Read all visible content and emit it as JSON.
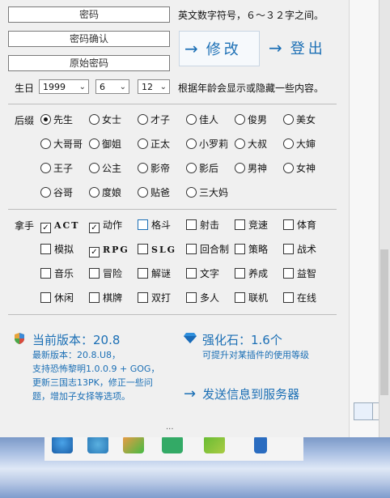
{
  "fields": {
    "password": "密码",
    "confirm": "密码确认",
    "original": "原始密码"
  },
  "password_hint": "英文数字符号，６～３２字之间。",
  "buttons": {
    "modify": "修改",
    "login": "登出"
  },
  "birthday": {
    "label": "生日",
    "year": "1999",
    "month": "6",
    "day": "12",
    "hint": "根据年龄会显示或隐藏一些内容。"
  },
  "suffix": {
    "label": "后缀",
    "options": [
      "先生",
      "女士",
      "才子",
      "佳人",
      "俊男",
      "美女",
      "大哥哥",
      "御姐",
      "正太",
      "小罗莉",
      "大叔",
      "大婶",
      "王子",
      "公主",
      "影帝",
      "影后",
      "男神",
      "女神",
      "谷哥",
      "度娘",
      "贴爸",
      "三大妈"
    ],
    "selected": "先生"
  },
  "skills": {
    "label": "拿手",
    "options": [
      "ACT",
      "动作",
      "格斗",
      "射击",
      "竞速",
      "体育",
      "模拟",
      "RPG",
      "SLG",
      "回合制",
      "策略",
      "战术",
      "音乐",
      "冒险",
      "解谜",
      "文字",
      "养成",
      "益智",
      "休闲",
      "棋牌",
      "双打",
      "多人",
      "联机",
      "在线"
    ],
    "checked": [
      "ACT",
      "动作",
      "RPG"
    ]
  },
  "version": {
    "current": "当前版本：20.8",
    "latest": "最新版本：20.8.U8，",
    "line2": "支持恐怖黎明1.0.0.9 + GOG，",
    "line3": "更新三国志13PK，修正一些问",
    "line4": "题，增加子女择等选项。"
  },
  "stone": {
    "title": "强化石：1.6个",
    "desc": "可提升对某插件的使用等级"
  },
  "send": "发送信息到服务器",
  "dots": "...",
  "colors": {
    "accent": "#1b6fb5"
  }
}
